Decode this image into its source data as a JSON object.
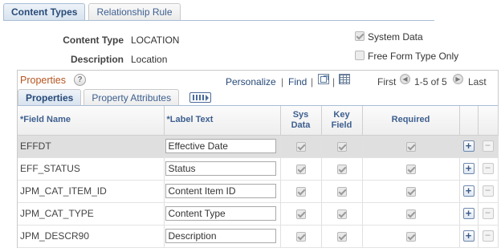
{
  "page_tabs": [
    {
      "label": "Content Types",
      "active": true
    },
    {
      "label": "Relationship Rule",
      "active": false
    }
  ],
  "header": {
    "content_type_label": "Content Type",
    "content_type_value": "LOCATION",
    "description_label": "Description",
    "description_value": "Location",
    "system_data_label": "System Data",
    "system_data_checked": true,
    "free_form_label": "Free Form Type Only",
    "free_form_checked": false
  },
  "grid": {
    "title": "Properties",
    "personalize": "Personalize",
    "sep1": "|",
    "find": "Find",
    "sep2": "|",
    "first": "First",
    "range": "1-5 of 5",
    "last": "Last",
    "sub_tabs": [
      {
        "label": "Properties",
        "active": true
      },
      {
        "label": "Property Attributes",
        "active": false
      }
    ],
    "columns": {
      "field_name": "*Field Name",
      "label_text": "*Label Text",
      "sys_data_1": "Sys",
      "sys_data_2": "Data",
      "key_field_1": "Key",
      "key_field_2": "Field",
      "required": "Required"
    },
    "rows": [
      {
        "field_name": "EFFDT",
        "label_text": "Effective Date",
        "sys_data": true,
        "key_field": true,
        "required": true
      },
      {
        "field_name": "EFF_STATUS",
        "label_text": "Status",
        "sys_data": true,
        "key_field": true,
        "required": true
      },
      {
        "field_name": "JPM_CAT_ITEM_ID",
        "label_text": "Content Item ID",
        "sys_data": true,
        "key_field": true,
        "required": true
      },
      {
        "field_name": "JPM_CAT_TYPE",
        "label_text": "Content Type",
        "sys_data": true,
        "key_field": true,
        "required": true
      },
      {
        "field_name": "JPM_DESCR90",
        "label_text": "Description",
        "sys_data": true,
        "key_field": true,
        "required": true
      }
    ],
    "add_symbol": "+",
    "delete_symbol": "−"
  }
}
